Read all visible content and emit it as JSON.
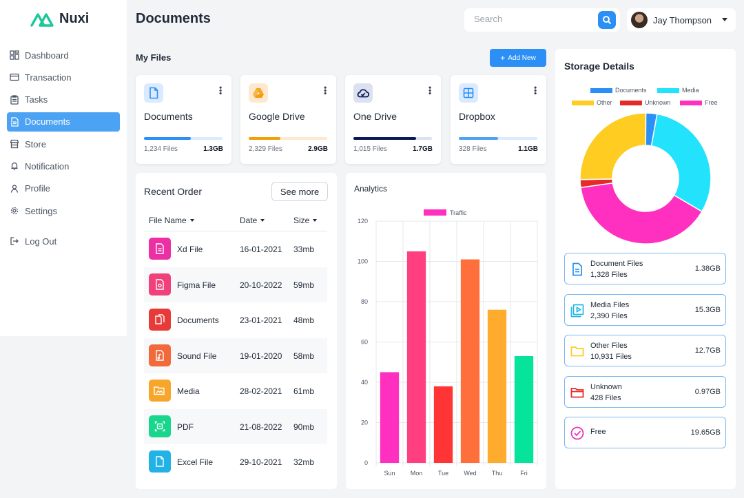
{
  "app": {
    "name": "Nuxi",
    "brand_color": "#1cc89a"
  },
  "nav": {
    "items": [
      {
        "label": "Dashboard",
        "icon": "dashboard-icon"
      },
      {
        "label": "Transaction",
        "icon": "card-icon"
      },
      {
        "label": "Tasks",
        "icon": "clipboard-icon"
      },
      {
        "label": "Documents",
        "icon": "document-icon",
        "active": true
      },
      {
        "label": "Store",
        "icon": "store-icon"
      },
      {
        "label": "Notification",
        "icon": "bell-icon"
      },
      {
        "label": "Profile",
        "icon": "person-icon"
      },
      {
        "label": "Settings",
        "icon": "gear-icon"
      }
    ],
    "logout": "Log Out"
  },
  "header": {
    "title": "Documents",
    "search_placeholder": "Search",
    "user_name": "Jay Thompson"
  },
  "my_files": {
    "title": "My Files",
    "add_new": "Add New",
    "cards": [
      {
        "name": "Documents",
        "files": "1,234 Files",
        "size": "1.3GB",
        "progress": 0.6,
        "color": "#2b8ff5",
        "track": "#dbeafe",
        "icon": "document-icon"
      },
      {
        "name": "Google Drive",
        "files": "2,329 Files",
        "size": "2.9GB",
        "progress": 0.4,
        "color": "#f59e0b",
        "track": "#fde9d0",
        "icon": "google-drive-icon"
      },
      {
        "name": "One Drive",
        "files": "1,015 Files",
        "size": "1.7GB",
        "progress": 0.8,
        "color": "#0b1a57",
        "track": "#dbe1f0",
        "icon": "cloud-icon"
      },
      {
        "name": "Dropbox",
        "files": "328 Files",
        "size": "1.1GB",
        "progress": 0.5,
        "color": "#4da3f3",
        "track": "#dbeafe",
        "icon": "dropbox-icon"
      }
    ]
  },
  "recent_order": {
    "title": "Recent Order",
    "see_more": "See more",
    "columns": [
      "File Name",
      "Date",
      "Size"
    ],
    "rows": [
      {
        "name": "Xd File",
        "date": "16-01-2021",
        "size": "33mb",
        "color": "#ec2fa3"
      },
      {
        "name": "Figma File",
        "date": "20-10-2022",
        "size": "59mb",
        "color": "#f0417a"
      },
      {
        "name": "Documents",
        "date": "23-01-2021",
        "size": "48mb",
        "color": "#e93a3a"
      },
      {
        "name": "Sound File",
        "date": "19-01-2020",
        "size": "58mb",
        "color": "#f26a3b"
      },
      {
        "name": "Media",
        "date": "28-02-2021",
        "size": "61mb",
        "color": "#f7a62b"
      },
      {
        "name": "PDF",
        "date": "21-08-2022",
        "size": "90mb",
        "color": "#19d68d"
      },
      {
        "name": "Excel File",
        "date": "29-10-2021",
        "size": "32mb",
        "color": "#23b2e6"
      }
    ]
  },
  "analytics": {
    "title": "Analytics",
    "chart_data": {
      "type": "bar",
      "categories": [
        "Sun",
        "Mon",
        "Tue",
        "Wed",
        "Thu",
        "Fri"
      ],
      "series": [
        {
          "name": "Traffic",
          "values": [
            45,
            105,
            38,
            101,
            76,
            53
          ]
        }
      ],
      "colors": [
        "#ff2fc0",
        "#ff3f7f",
        "#ff3535",
        "#ff6f3c",
        "#ffab2e",
        "#06e39a"
      ],
      "legend_color": "#ff2fc0",
      "yticks": [
        0,
        20,
        40,
        60,
        80,
        100,
        120
      ],
      "ylim": [
        0,
        120
      ],
      "grid": true,
      "legend": "top"
    }
  },
  "storage": {
    "title": "Storage Details",
    "chart_data": {
      "type": "pie",
      "labels": [
        "Documents",
        "Media",
        "Free",
        "Unknown",
        "Other"
      ],
      "values": [
        2.75,
        30.4,
        39.05,
        1.93,
        25.2
      ],
      "colors": [
        "#2b8ff5",
        "#22e3fb",
        "#ff2fc0",
        "#e62a2a",
        "#ffcc22"
      ],
      "legend": "top"
    },
    "legend": [
      {
        "label": "Documents",
        "color": "#2b8ff5"
      },
      {
        "label": "Media",
        "color": "#22e3fb"
      },
      {
        "label": "Other",
        "color": "#ffcc22"
      },
      {
        "label": "Unknown",
        "color": "#e62a2a"
      },
      {
        "label": "Free",
        "color": "#ff2fc0"
      }
    ],
    "items": [
      {
        "name": "Document Files",
        "count": "1,328 Files",
        "size": "1.38GB",
        "icon": "document-icon",
        "color": "#2b8ff5"
      },
      {
        "name": "Media Files",
        "count": "2,390 Files",
        "size": "15.3GB",
        "icon": "media-icon",
        "color": "#22b6e6"
      },
      {
        "name": "Other Files",
        "count": "10,931 Files",
        "size": "12.7GB",
        "icon": "folder-icon",
        "color": "#ffcc22"
      },
      {
        "name": "Unknown",
        "count": "428 Files",
        "size": "0.97GB",
        "icon": "folder-icon",
        "color": "#e62a2a"
      },
      {
        "name": "Free",
        "count": "",
        "size": "19.65GB",
        "icon": "check-circle-icon",
        "color": "#e535b8"
      }
    ]
  }
}
